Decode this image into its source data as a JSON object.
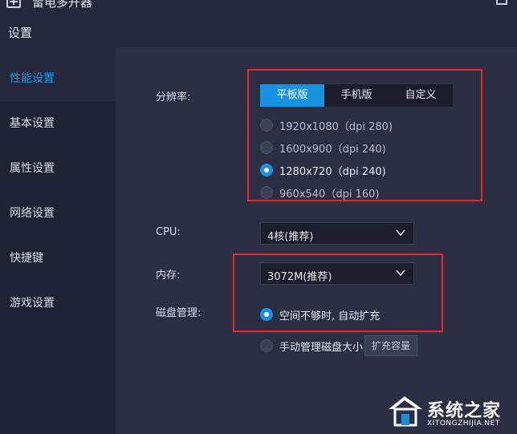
{
  "app": {
    "title": "雷电多开器",
    "icon": "plus-square-icon"
  },
  "header": {
    "title": "设置"
  },
  "sidebar": {
    "items": [
      {
        "label": "性能设置",
        "active": true
      },
      {
        "label": "基本设置",
        "active": false
      },
      {
        "label": "属性设置",
        "active": false
      },
      {
        "label": "网络设置",
        "active": false
      },
      {
        "label": "快捷键",
        "active": false
      },
      {
        "label": "游戏设置",
        "active": false
      }
    ]
  },
  "resolution": {
    "label": "分辨率:",
    "tabs": [
      {
        "label": "平板版",
        "active": true
      },
      {
        "label": "手机版",
        "active": false
      },
      {
        "label": "自定义",
        "active": false
      }
    ],
    "options": [
      {
        "label": "1920x1080（dpi 280)",
        "checked": false
      },
      {
        "label": "1600x900（dpi 240)",
        "checked": false
      },
      {
        "label": "1280x720（dpi 240)",
        "checked": true
      },
      {
        "label": "960x540（dpi 160)",
        "checked": false
      }
    ]
  },
  "cpu": {
    "label": "CPU:",
    "value": "4核(推荐)"
  },
  "memory": {
    "label": "内存:",
    "value": "3072M(推荐)"
  },
  "disk": {
    "label": "磁盘管理:",
    "options": [
      {
        "label": "空间不够时, 自动扩充",
        "checked": true
      },
      {
        "label": "手动管理磁盘大小",
        "checked": false
      }
    ],
    "expand_button": "扩充容量"
  },
  "watermark": {
    "text": "系统之家",
    "url": "XITONGZHIJIA.NET"
  },
  "colors": {
    "accent": "#1892e2",
    "highlight_box": "#e8262b",
    "active_sidebar_text": "#1d9bf0"
  }
}
